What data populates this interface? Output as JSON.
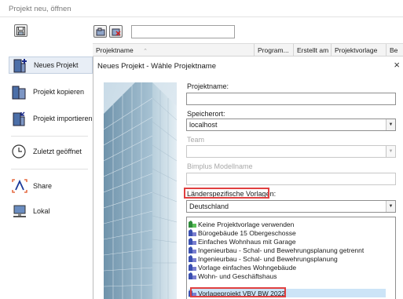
{
  "window": {
    "title": "Projekt neu, öffnen"
  },
  "toolbar": {
    "search_value": ""
  },
  "sidebar": {
    "items": [
      {
        "label": "Neues Projekt",
        "icon": "new-project-icon"
      },
      {
        "label": "Projekt kopieren",
        "icon": "copy-project-icon"
      },
      {
        "label": "Projekt importieren",
        "icon": "import-project-icon"
      },
      {
        "label": "Zuletzt geöffnet",
        "icon": "clock-icon"
      },
      {
        "label": "Share",
        "icon": "share-icon"
      },
      {
        "label": "Lokal",
        "icon": "computer-icon"
      }
    ]
  },
  "table": {
    "columns": [
      "Projektname",
      "Program...",
      "Erstellt am",
      "Projektvorlage",
      "Be"
    ]
  },
  "dialog": {
    "title": "Neues Projekt - Wähle Projektname",
    "close_glyph": "×",
    "projektname_label": "Projektname:",
    "projektname_value": "",
    "speicherort_label": "Speicherort:",
    "speicherort_value": "localhost",
    "team_label": "Team",
    "team_value": "",
    "bimplus_label": "Bimplus Modellname",
    "bimplus_value": "",
    "laender_label": "Länderspezifische Vorlagen:",
    "laender_value": "Deutschland",
    "templates": [
      {
        "label": "Keine Projektvorlage verwenden",
        "icon": "green"
      },
      {
        "label": "Bürogebäude 15 Obergeschosse",
        "icon": "blue"
      },
      {
        "label": "Einfaches Wohnhaus mit Garage",
        "icon": "blue"
      },
      {
        "label": "Ingenieurbau - Schal- und Bewehrungsplanung getrennt",
        "icon": "blue"
      },
      {
        "label": "Ingenieurbau - Schal- und Bewehrungsplanung",
        "icon": "blue"
      },
      {
        "label": "Vorlage einfaches Wohngebäude",
        "icon": "blue"
      },
      {
        "label": "Wohn- und Geschäftshaus",
        "icon": "blue"
      },
      {
        "label": "Vorlageprojekt VBV BW 2022",
        "icon": "blue"
      }
    ],
    "selected_template_index": 7
  },
  "colors": {
    "highlight_red": "#e04040",
    "selection_blue": "#cce4f7"
  }
}
